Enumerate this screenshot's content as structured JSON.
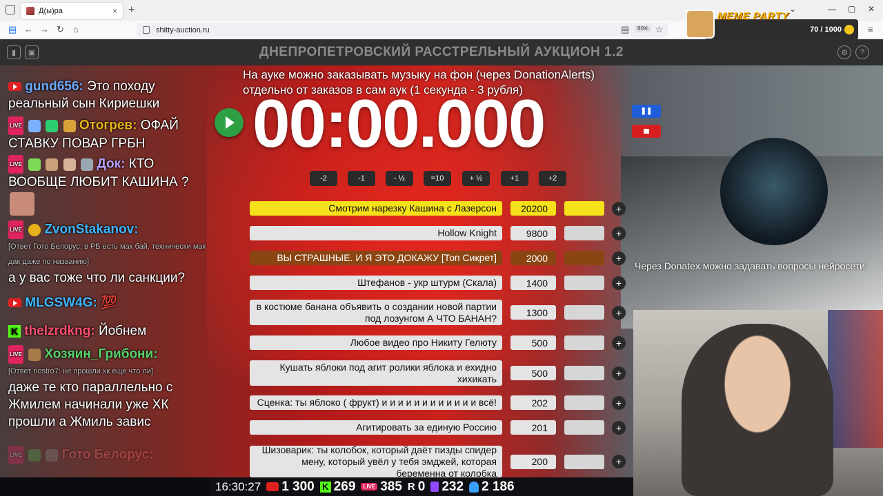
{
  "browser": {
    "tab_title": "Д(ы)ра",
    "tab_close": "×",
    "new_tab": "+",
    "url": "shitty-auction.ru",
    "zoom": "80%",
    "nav": {
      "back": "←",
      "forward": "→",
      "reload": "↻",
      "home": "⌂",
      "bookmark": "☆",
      "reader": "▤"
    },
    "window": {
      "minimize": "—",
      "maximize": "▢",
      "close": "✕",
      "menu": "≡",
      "collapse": "⌄"
    }
  },
  "meme_party": {
    "title": "MEME PARTY",
    "progress": "70 / 1000",
    "current": 70,
    "goal": 1000
  },
  "app": {
    "title": "ДНЕПРОПЕТРОВСКИЙ РАССТРЕЛЬНЫЙ АУКЦИОН 1.2",
    "notice_line1": "На ауке можно заказывать музыку на фон (через DonationAlerts)",
    "notice_line2": "отдельно от заказов в сам аук (1 секунда - 3 рубля)",
    "timer": "00:00.000",
    "pause_label": "❚❚",
    "adjust_buttons": [
      "-2",
      "-1",
      "- ½",
      "=10",
      "+ ½",
      "+1",
      "+2"
    ],
    "settings_icon": "⚙",
    "help_icon": "?"
  },
  "lots": [
    {
      "name": "Смотрим нарезку Кашина с Лазерсон",
      "amount": "20200",
      "style": "yellow"
    },
    {
      "name": "Hollow Knight",
      "amount": "9800",
      "style": "normal"
    },
    {
      "name": "ВЫ СТРАШНЫЕ. И Я ЭТО ДОКАЖУ [Топ Сикрет]",
      "amount": "2000",
      "style": "brown"
    },
    {
      "name": "Штефанов - укр штурм (Скала)",
      "amount": "1400",
      "style": "normal"
    },
    {
      "name": "в костюме банана объявить о создании новой партии под лозунгом А ЧТО БАНАН?",
      "amount": "1300",
      "style": "normal"
    },
    {
      "name": "Любое видео про Никиту Гелюту",
      "amount": "500",
      "style": "normal"
    },
    {
      "name": "Кушать яблоки под агит ролики яблока и ехидно хихикать",
      "amount": "500",
      "style": "normal"
    },
    {
      "name": "Сценка: ты яблоко ( фрукт) и и и и и и и и и и и и всё!",
      "amount": "202",
      "style": "normal"
    },
    {
      "name": "Агитировать за единую Россию",
      "amount": "201",
      "style": "normal"
    },
    {
      "name": "Шизоварик: ты колобок, который даёт пизды спидер мену, который увёл у тебя эмджей, которая беременна от колобка",
      "amount": "200",
      "style": "normal"
    }
  ],
  "lot_plus": "+",
  "chat": [
    {
      "name": "gund656:",
      "text": "Это походу реальный сын Кириешки",
      "color": "#6aa9ff"
    },
    {
      "name": "Отогрев:",
      "text": "ОФАЙ СТАВКУ  ПОВАР ГРБН",
      "color": "#e8b21a"
    },
    {
      "name": "Док:",
      "text": "КТО ВООБЩЕ ЛЮБИТ КАШИНА ?",
      "color": "#b8a0ff"
    },
    {
      "name": "ZvonStakanov:",
      "reply": "[Ответ Гото Белорус: в РБ есть мак бай, технически мак дак даже по названию]",
      "text": "а у вас тоже что ли санкции?",
      "color": "#3fb6ff"
    },
    {
      "name": "MLGSW4G:",
      "text": "💯",
      "color": "#3fb6ff"
    },
    {
      "name": "thelzrdkng:",
      "text": "Йобнем",
      "color": "#ff4d6d"
    },
    {
      "name": "Хозяин_Грибони:",
      "reply": "[Ответ nostro7: не прошли хк еще что ли]",
      "text": "даже те кто параллельно с Жмилем начинали уже ХК прошли а Жмиль завис",
      "color": "#58d26a"
    },
    {
      "name": "Гото Белорус:",
      "text": "",
      "color": "#ff6a6a"
    }
  ],
  "ai_note": "Через Donatex можно задавать вопросы нейросети",
  "stats": {
    "clock": "16:30:27",
    "youtube": "1 300",
    "kick": "269",
    "vk": "385",
    "rutube": "0",
    "twitch": "232",
    "total": "2 186",
    "r_label": "R"
  }
}
